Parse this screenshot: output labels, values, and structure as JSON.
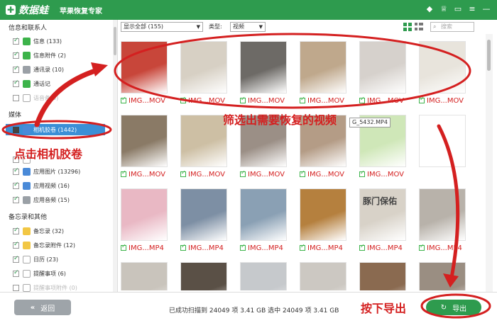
{
  "app": {
    "logo_letter": "✚",
    "name": "数据蛙",
    "subtitle": "苹果恢复专家"
  },
  "titlebar_icons": [
    "diamond-icon",
    "shirt-icon",
    "message-icon",
    "menu-icon",
    "minimize-icon"
  ],
  "sidebar": {
    "sections": [
      {
        "title": "信息和联系人",
        "items": [
          {
            "label": "信息 (133)",
            "icon": "message-icon",
            "checked": true
          },
          {
            "label": "信息附件 (2)",
            "icon": "attachment-icon",
            "checked": true
          },
          {
            "label": "通讯录 (10)",
            "icon": "contacts-icon",
            "checked": true
          },
          {
            "label": "通话记",
            "icon": "phone-icon",
            "checked": true
          },
          {
            "label": "语音备(0)",
            "icon": "voicemail-icon",
            "checked": false
          }
        ]
      },
      {
        "title": "媒体",
        "items": [
          {
            "label": "相机胶卷 (1442)",
            "icon": "camera-icon",
            "checked": true,
            "selected": true
          },
          {
            "label": "",
            "icon": "photo-icon",
            "checked": true
          },
          {
            "label": "应用图片 (13296)",
            "icon": "app-photo-icon",
            "checked": true
          },
          {
            "label": "应用视频 (16)",
            "icon": "app-video-icon",
            "checked": true
          },
          {
            "label": "应用音频 (15)",
            "icon": "app-audio-icon",
            "checked": true
          }
        ]
      },
      {
        "title": "备忘录和其他",
        "items": [
          {
            "label": "备忘录 (32)",
            "icon": "note-icon",
            "checked": true
          },
          {
            "label": "备忘录附件 (12)",
            "icon": "note-attachment-icon",
            "checked": true
          },
          {
            "label": "日历 (23)",
            "icon": "calendar-icon",
            "checked": true
          },
          {
            "label": "提醒事项 (6)",
            "icon": "reminder-icon",
            "checked": true
          },
          {
            "label": "提醒事项附件 (0)",
            "icon": "reminder-attachment-icon",
            "checked": false
          }
        ]
      }
    ]
  },
  "toolbar": {
    "show_filter": "显示全部 (155)",
    "type_label": "类型:",
    "type_value": "视频",
    "search_placeholder": "搜索"
  },
  "grid": {
    "tiles": [
      {
        "label": "IMG...MOV",
        "color": "#c8463a"
      },
      {
        "label": "IMG...MOV",
        "color": "#d7d0c4"
      },
      {
        "label": "IMG...MOV",
        "color": "#6d6a66"
      },
      {
        "label": "IMG...MOV",
        "color": "#bfa88c"
      },
      {
        "label": "IMG...MOV",
        "color": "#d6d1cc"
      },
      {
        "label": "IMG...MOV",
        "color": "#e8e4dc"
      },
      {
        "label": "IMG...MOV",
        "color": "#8a7a66"
      },
      {
        "label": "IMG...MOV",
        "color": "#cdbfa4"
      },
      {
        "label": "IMG...MOV",
        "color": "#9b8f86"
      },
      {
        "label": "IMG...MOV",
        "color": "#b49c86"
      },
      {
        "label": "IMG...MOV",
        "color": "#cfe7b8"
      },
      {
        "label": "",
        "color": "#ffffff"
      },
      {
        "label": "IMG...MP4",
        "color": "#e9b8c4"
      },
      {
        "label": "IMG...MP4",
        "color": "#7d8fa4"
      },
      {
        "label": "IMG...MP4",
        "color": "#8aa0b4"
      },
      {
        "label": "IMG...MP4",
        "color": "#b5803e"
      },
      {
        "label": "IMG...MP4",
        "color": "#d8d2c8"
      },
      {
        "label": "IMG...MP4",
        "color": "#b8b2aa"
      },
      {
        "label": "",
        "color": "#c9c4bc"
      },
      {
        "label": "",
        "color": "#5a5046"
      },
      {
        "label": "",
        "color": "#c6c9cc"
      },
      {
        "label": "",
        "color": "#ccc8c2"
      },
      {
        "label": "",
        "color": "#8a6a50"
      },
      {
        "label": "",
        "color": "#9a8e82"
      }
    ],
    "tooltip": "G_5432.MP4",
    "thumb_text": "豚门保佑"
  },
  "annotations": {
    "filter_note": "筛选出需要恢复的视频",
    "camera_note": "点击相机胶卷",
    "export_note": "按下导出"
  },
  "bottombar": {
    "back_label": "返回",
    "status": "已成功扫描到 24049 项 3.41 GB  选中 24049 项 3.41 GB",
    "export_label": "导出"
  },
  "colors": {
    "brand": "#2e9b4e",
    "annotation": "#d42020",
    "selected": "#3b8fd6"
  }
}
